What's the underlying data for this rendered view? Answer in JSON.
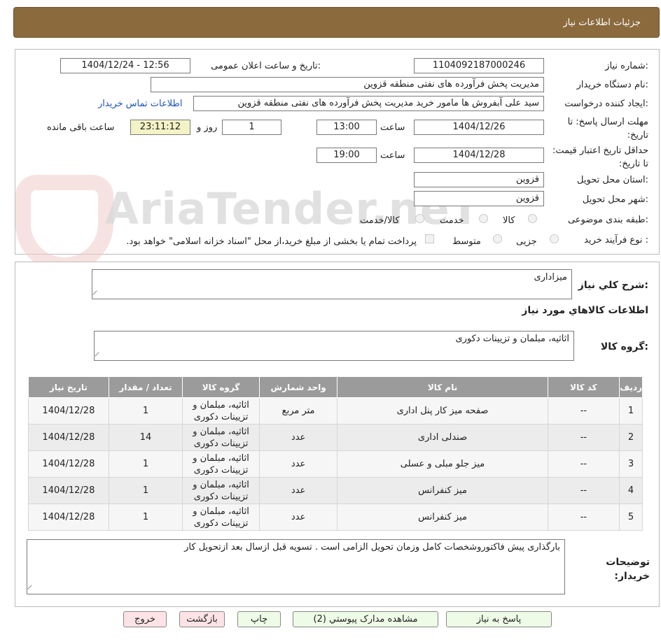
{
  "header": {
    "title": "جزئیات اطلاعات نیاز"
  },
  "form": {
    "need_number_label": "شماره نیاز:",
    "need_number": "1104092187000246",
    "announce_label": "تاریخ و ساعت اعلان عمومی:",
    "announce_value": "1404/12/24 - 12:56",
    "buyer_org_label": "نام دستگاه خریدار:",
    "buyer_org": "مدیریت پخش فرآورده های نفتی منطقه قزوین",
    "creator_label": "ایجاد کننده درخواست:",
    "creator": "سید علی  آبفروش ها مامور خرید مدیریت پخش فرآورده های نفتی منطقه قزوین",
    "contact_link": "اطلاعات تماس خریدار",
    "deadline_label": "مهلت ارسال پاسخ: تا تاریخ:",
    "deadline_date": "1404/12/26",
    "time_label": "ساعت",
    "deadline_time": "13:00",
    "days_value": "1",
    "days_label": "روز و",
    "remaining_value": "23:11:12",
    "remaining_label": "ساعت باقی مانده",
    "validity_label": "حداقل تاریخ اعتبار قیمت: تا تاریخ:",
    "validity_date": "1404/12/28",
    "validity_time": "19:00",
    "province_label": "استان محل تحویل:",
    "province": "قزوین",
    "city_label": "شهر محل تحویل:",
    "city": "قزوین",
    "category_label": "طبقه بندی موضوعی:",
    "category_options": [
      "کالا",
      "خدمت",
      "کالا/خدمت"
    ],
    "process_label": "نوع فرآیند خرید :",
    "process_options": [
      "جزیی",
      "متوسط"
    ],
    "payment_note": "پرداخت تمام یا بخشی از مبلغ خرید،از محل \"اسناد خزانه اسلامی\" خواهد بود."
  },
  "summary": {
    "desc_label": "شرح کلي نیاز:",
    "desc_value": "میزاداری",
    "goods_info_title": "اطلاعات کالاهاي مورد نیاز",
    "goods_group_label": "گروه کالا:",
    "goods_group_value": "اثاثیه، مبلمان و تزیینات دکوری"
  },
  "table": {
    "headers": [
      "ردیف",
      "کد کالا",
      "نام کالا",
      "واحد شمارش",
      "گروه کالا",
      "تعداد / مقدار",
      "تاریخ نیاز"
    ],
    "rows": [
      [
        "1",
        "--",
        "صفحه میز کار پنل اداری",
        "متر مربع",
        "اثاثیه، مبلمان و تزیینات دکوری",
        "1",
        "1404/12/28"
      ],
      [
        "2",
        "--",
        "صندلی اداری",
        "عدد",
        "اثاثیه، مبلمان و تزیینات دکوری",
        "14",
        "1404/12/28"
      ],
      [
        "3",
        "--",
        "میز جلو مبلی و عسلی",
        "عدد",
        "اثاثیه، مبلمان و تزیینات دکوری",
        "1",
        "1404/12/28"
      ],
      [
        "4",
        "--",
        "میز کنفرانس",
        "عدد",
        "اثاثیه، مبلمان و تزیینات دکوری",
        "1",
        "1404/12/28"
      ],
      [
        "5",
        "--",
        "میز کنفرانس",
        "عدد",
        "اثاثیه، مبلمان و تزیینات دکوری",
        "1",
        "1404/12/28"
      ]
    ]
  },
  "notes": {
    "label": "توضیحات خریدار:",
    "value": "بارگذاری پیش فاکتوروشخصات کامل وزمان تحویل الزامی است . تسویه قبل ازسال بعد ازتحویل کار"
  },
  "buttons": {
    "reply": "پاسخ به نیاز",
    "attachments": "مشاهده مدارک پیوستي (2)",
    "print": "چاپ",
    "back": "بازگشت",
    "exit": "خروج"
  },
  "watermark": {
    "text": "AriaTender.neT"
  }
}
